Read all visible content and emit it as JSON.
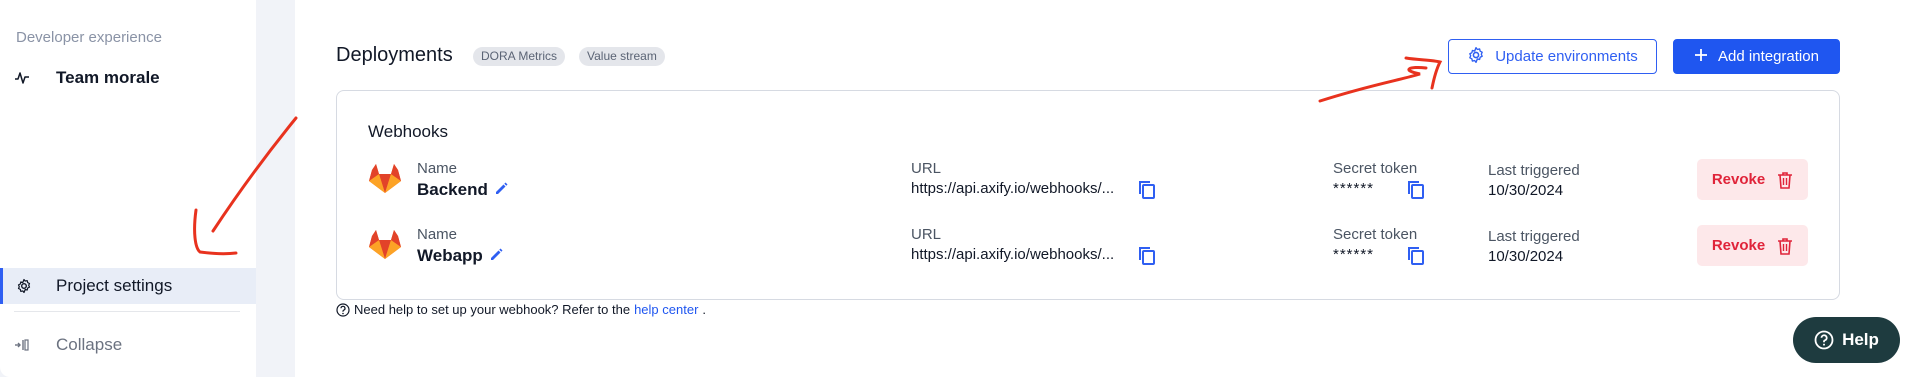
{
  "sidebar": {
    "section_label": "Developer experience",
    "items": [
      {
        "label": "Team morale",
        "icon": "activity-icon"
      },
      {
        "label": "Project settings",
        "icon": "gear-icon"
      },
      {
        "label": "Collapse",
        "icon": "collapse-icon"
      }
    ]
  },
  "header": {
    "title": "Deployments",
    "badges": [
      "DORA Metrics",
      "Value stream"
    ],
    "update_env_label": "Update environments",
    "add_integration_label": "Add integration"
  },
  "webhooks": {
    "title": "Webhooks",
    "labels": {
      "name": "Name",
      "url": "URL",
      "secret": "Secret token",
      "last": "Last triggered",
      "revoke": "Revoke"
    },
    "rows": [
      {
        "name": "Backend",
        "url": "https://api.axify.io/webhooks/...",
        "token": "******",
        "last_triggered": "10/30/2024"
      },
      {
        "name": "Webapp",
        "url": "https://api.axify.io/webhooks/...",
        "token": "******",
        "last_triggered": "10/30/2024"
      }
    ]
  },
  "help": {
    "text": "Need help to set up your webhook? Refer to the",
    "link": "help center",
    "end": ".",
    "fab_label": "Help"
  },
  "colors": {
    "accent": "#1f56f0",
    "revoke": "#e0243a",
    "annotation": "#e8321e",
    "help_fab": "#1e3b3f"
  }
}
